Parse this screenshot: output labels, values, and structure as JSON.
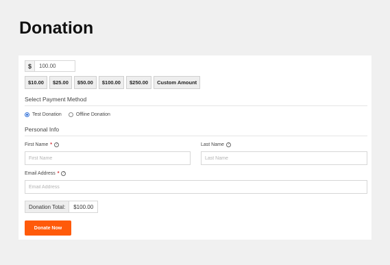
{
  "page": {
    "title": "Donation"
  },
  "amount": {
    "currency": "$",
    "value": "100.00"
  },
  "levels": [
    "$10.00",
    "$25.00",
    "$50.00",
    "$100.00",
    "$250.00",
    "Custom Amount"
  ],
  "payment": {
    "title": "Select Payment Method",
    "options": [
      {
        "label": "Test Donation",
        "selected": true
      },
      {
        "label": "Offline Donation",
        "selected": false
      }
    ]
  },
  "personal": {
    "title": "Personal Info",
    "first_name": {
      "label": "First Name",
      "required": "*",
      "placeholder": "First Name"
    },
    "last_name": {
      "label": "Last Name",
      "placeholder": "Last Name"
    },
    "email": {
      "label": "Email Address",
      "required": "*",
      "placeholder": "Email Address"
    }
  },
  "total": {
    "label": "Donation Total:",
    "value": "$100.00"
  },
  "submit": {
    "label": "Donate Now"
  },
  "colors": {
    "accent": "#ff5a0a",
    "background": "#f0f0f0",
    "radio": "#2e6fd8"
  }
}
